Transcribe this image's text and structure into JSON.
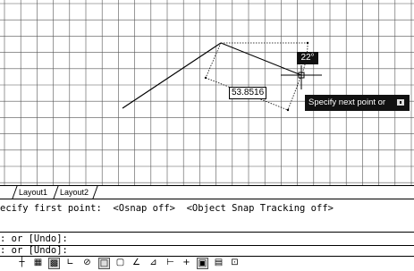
{
  "drawing": {
    "length_value": "53.8516",
    "angle_value": "22°",
    "prompt_text": "Specify next point or"
  },
  "tabs": [
    {
      "label": "Layout1"
    },
    {
      "label": "Layout2"
    }
  ],
  "command": {
    "history_line": "ecify first point:  <Osnap off>  <Object Snap Tracking off>",
    "line2": ": or [Undo]:",
    "line3": ": or [Undo]:"
  },
  "status_icons": [
    "snap-icon",
    "grid-display-icon",
    "grid-icon",
    "ortho-icon",
    "polar-tracking-icon",
    "object-snap-icon",
    "object-snap-tracking-icon",
    "ucs-icon",
    "dynamic-input-icon",
    "lineweight-icon",
    "crosshair-icon",
    "transparency-icon",
    "quick-properties-icon",
    "selection-cycling-icon"
  ]
}
